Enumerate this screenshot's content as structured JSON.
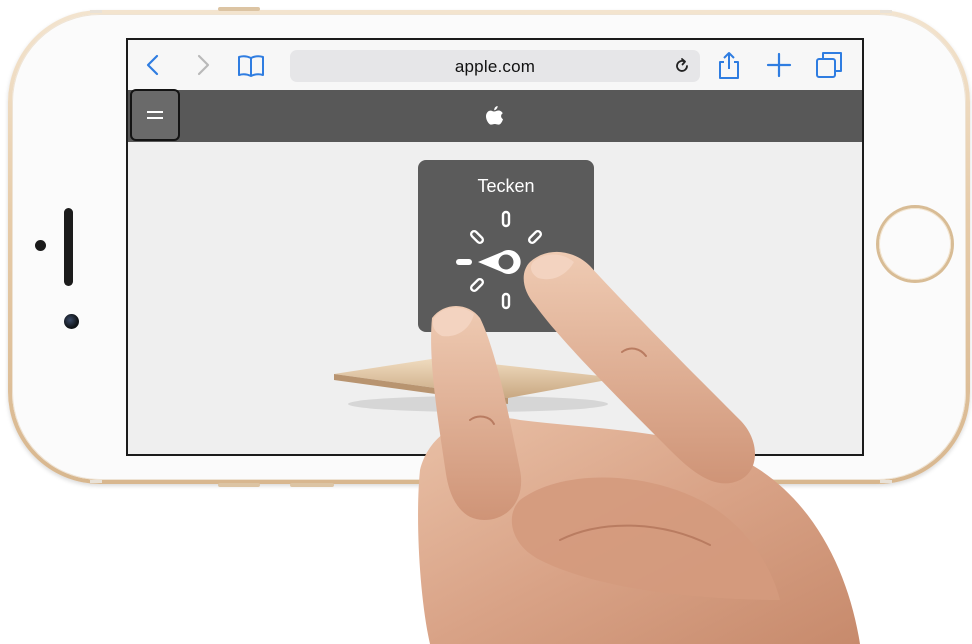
{
  "safari": {
    "url": "apple.com",
    "icons": {
      "back": "chevron-left-icon",
      "forward": "chevron-right-icon",
      "bookmarks": "book-icon",
      "reload": "reload-icon",
      "share": "share-icon",
      "new_tab": "plus-icon",
      "tabs": "tabs-icon"
    },
    "accent_color": "#2f7de1"
  },
  "site_nav": {
    "menu_icon": "menu-icon",
    "logo_icon": "apple-logo-icon"
  },
  "voiceover_rotor": {
    "title": "Tecken"
  }
}
